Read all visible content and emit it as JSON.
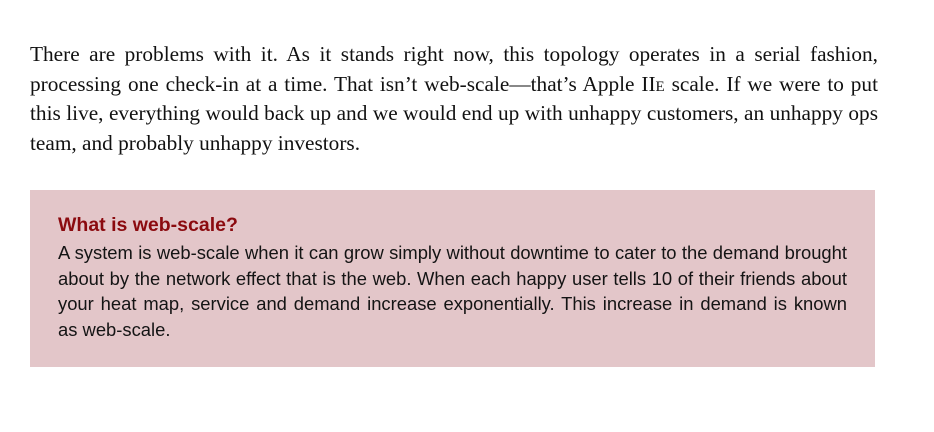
{
  "paragraph": {
    "part1": "There are problems with it. As it stands right now, this topology operates in a serial fashion, processing one check-in at a time. That isn’t web-scale—that’s Apple ",
    "smallcaps": "IIe",
    "part2": " scale. If we were to put this live, everything would back up and we would end up with unhappy customers, an unhappy ops team, and probably unhappy investors."
  },
  "sidebar": {
    "title": "What is web-scale?",
    "body": "A system is web-scale when it can grow simply without downtime to cater to the demand brought about by the network effect that is the web. When each happy user tells 10 of their friends about your heat map, service and demand increase exponen­tially. This increase in demand is known as web-scale."
  },
  "colors": {
    "sidebar_background": "#e3c6c9",
    "sidebar_title": "#8b0a0f",
    "text": "#111111"
  }
}
